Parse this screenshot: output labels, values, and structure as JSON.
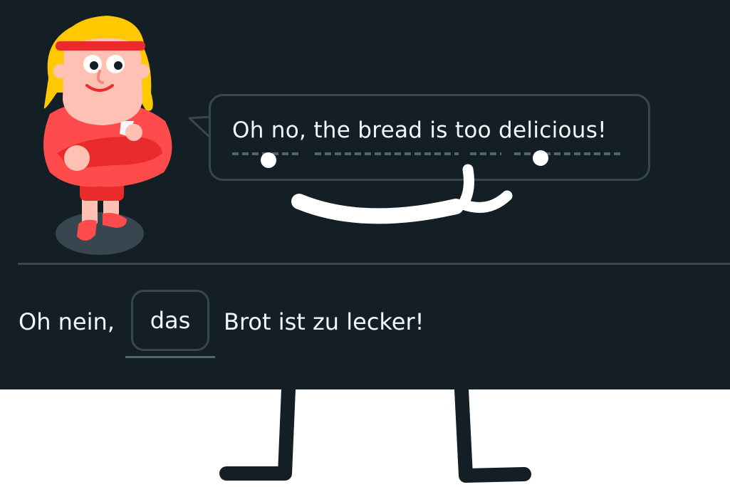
{
  "prompt": {
    "sentence": "Oh no, the bread is too delicious!"
  },
  "answer": {
    "before_blank": "Oh nein,",
    "selected_word": "das",
    "after_blank": "Brot ist zu lecker!"
  },
  "colors": {
    "panel_background": "#131f24",
    "border": "#37464f",
    "text": "#f1f7fb",
    "character_shirt": "#ff4b4b",
    "character_hair": "#ffc800",
    "marker_white": "#ffffff",
    "marker_black": "#131f24"
  }
}
